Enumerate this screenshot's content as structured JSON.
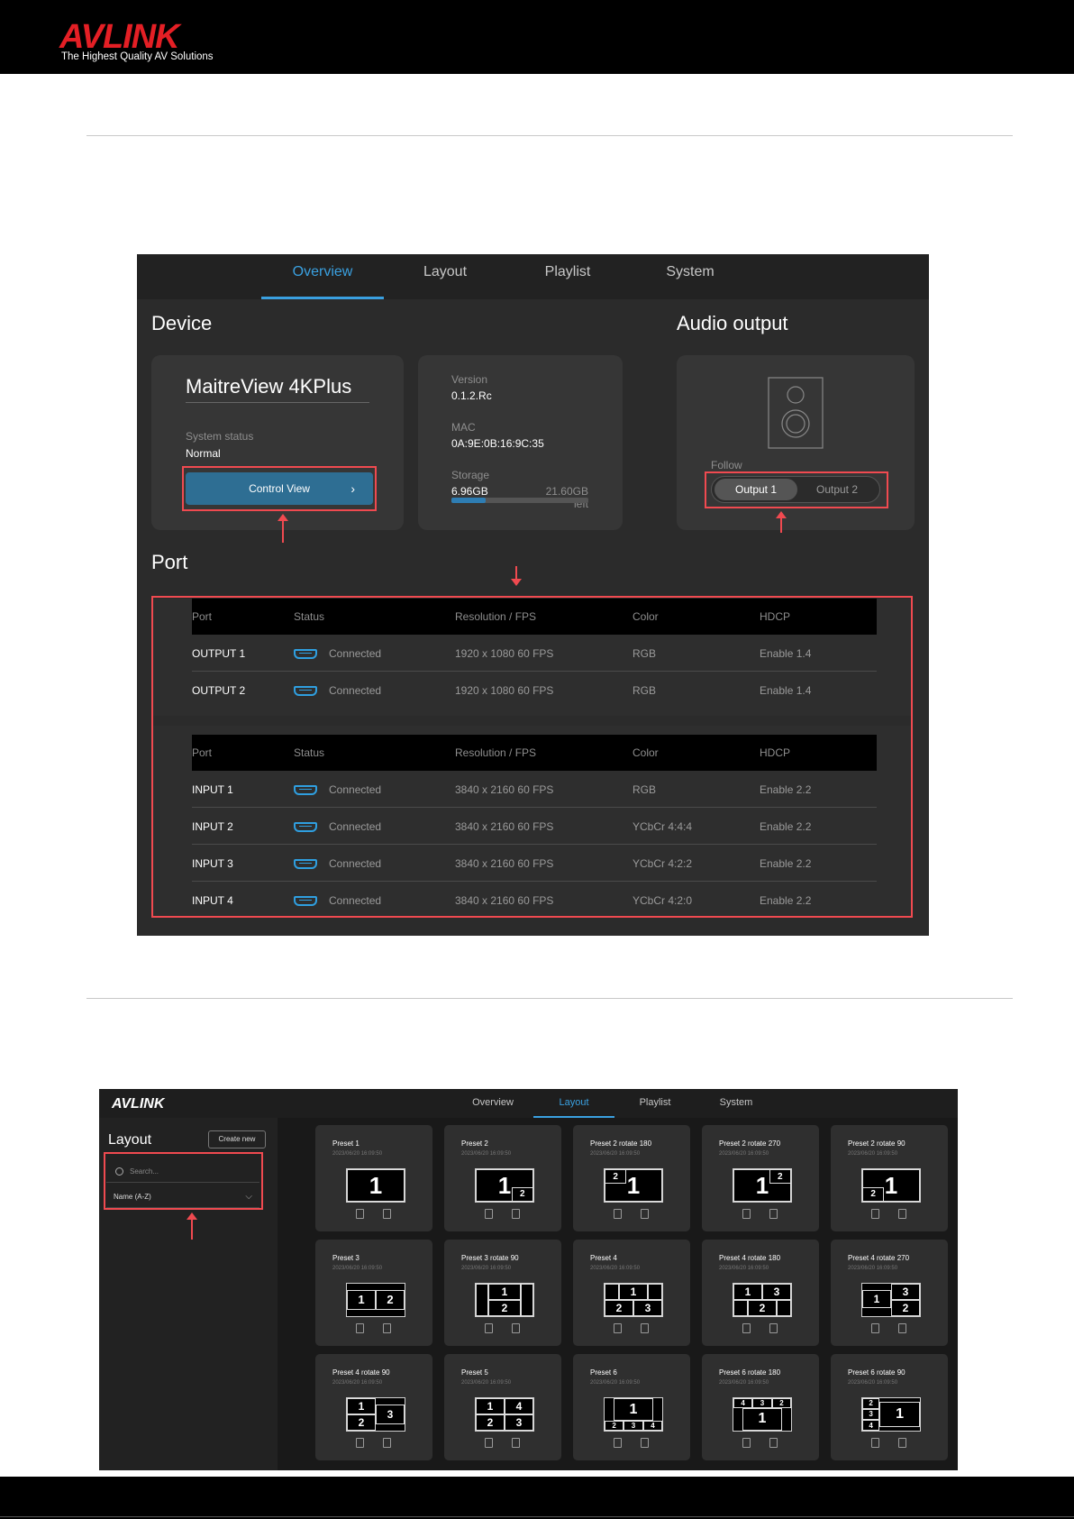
{
  "header": {
    "logo_text": "AVLINK",
    "tagline": "The Highest Quality AV Solutions"
  },
  "screen1": {
    "tabs": [
      "Overview",
      "Layout",
      "Playlist",
      "System"
    ],
    "active_tab": "Overview",
    "device": {
      "section_title": "Device",
      "name": "MaitreView 4KPlus",
      "status_label": "System status",
      "status_value": "Normal",
      "control_button": "Control View",
      "version_label": "Version",
      "version_value": "0.1.2.Rc",
      "mac_label": "MAC",
      "mac_value": "0A:9E:0B:16:9C:35",
      "storage_label": "Storage",
      "storage_used": "6.96GB",
      "storage_left": "21.60GB left",
      "storage_fraction": 0.25
    },
    "audio": {
      "section_title": "Audio output",
      "follow_label": "Follow",
      "options": [
        "Output 1",
        "Output 2"
      ],
      "selected": "Output 1"
    },
    "port": {
      "section_title": "Port",
      "columns": [
        "Port",
        "Status",
        "Resolution / FPS",
        "Color",
        "HDCP"
      ],
      "outputs": [
        [
          "OUTPUT 1",
          "Connected",
          "1920 x 1080 60 FPS",
          "RGB",
          "Enable 1.4"
        ],
        [
          "OUTPUT 2",
          "Connected",
          "1920 x 1080 60 FPS",
          "RGB",
          "Enable 1.4"
        ]
      ],
      "inputs": [
        [
          "INPUT 1",
          "Connected",
          "3840 x 2160 60 FPS",
          "RGB",
          "Enable 2.2"
        ],
        [
          "INPUT 2",
          "Connected",
          "3840 x 2160 60 FPS",
          "YCbCr 4:4:4",
          "Enable 2.2"
        ],
        [
          "INPUT 3",
          "Connected",
          "3840 x 2160 60 FPS",
          "YCbCr 4:2:2",
          "Enable 2.2"
        ],
        [
          "INPUT 4",
          "Connected",
          "3840 x 2160 60 FPS",
          "YCbCr 4:2:0",
          "Enable 2.2"
        ]
      ]
    }
  },
  "screen2": {
    "logo_text": "AVLINK",
    "tabs": [
      "Overview",
      "Layout",
      "Playlist",
      "System"
    ],
    "active_tab": "Layout",
    "sidebar": {
      "title": "Layout",
      "create_button": "Create new",
      "search_placeholder": "Search...",
      "sort_value": "Name (A-Z)"
    },
    "presets": [
      {
        "name": "Preset 1",
        "date": "2023/06/20 16:09:50"
      },
      {
        "name": "Preset 2",
        "date": "2023/06/20 16:09:50"
      },
      {
        "name": "Preset 2 rotate 180",
        "date": "2023/06/20 16:09:50"
      },
      {
        "name": "Preset 2 rotate 270",
        "date": "2023/06/20 16:09:50"
      },
      {
        "name": "Preset 2 rotate 90",
        "date": "2023/06/20 16:09:50"
      },
      {
        "name": "Preset 3",
        "date": "2023/06/20 16:09:50"
      },
      {
        "name": "Preset 3 rotate 90",
        "date": "2023/06/20 16:09:50"
      },
      {
        "name": "Preset 4",
        "date": "2023/06/20 16:09:50"
      },
      {
        "name": "Preset 4 rotate 180",
        "date": "2023/06/20 16:09:50"
      },
      {
        "name": "Preset 4 rotate 270",
        "date": "2023/06/20 16:09:50"
      },
      {
        "name": "Preset 4 rotate 90",
        "date": "2023/06/20 16:09:50"
      },
      {
        "name": "Preset 5",
        "date": "2023/06/20 16:09:50"
      },
      {
        "name": "Preset 6",
        "date": "2023/06/20 16:09:50"
      },
      {
        "name": "Preset 6 rotate 180",
        "date": "2023/06/20 16:09:50"
      },
      {
        "name": "Preset 6 rotate 90",
        "date": "2023/06/20 16:09:50"
      }
    ]
  }
}
